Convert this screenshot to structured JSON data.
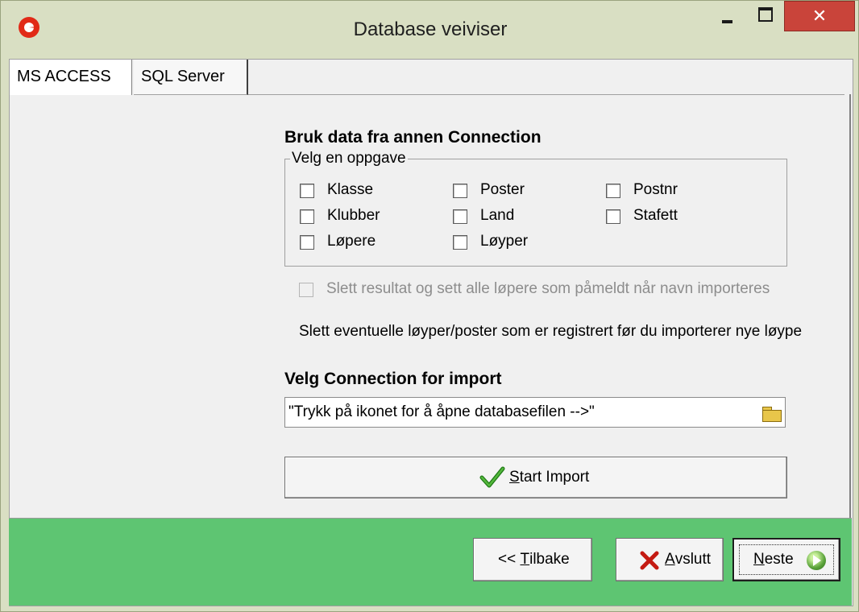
{
  "window": {
    "title": "Database veiviser",
    "app_icon": "app-logo-icon",
    "close_glyph": "✕"
  },
  "tabs": [
    {
      "label": "MS ACCESS",
      "active": true
    },
    {
      "label": "SQL Server",
      "active": false
    }
  ],
  "import_section": {
    "heading": "Bruk data fra annen Connection",
    "group_label": "Velg en oppgave",
    "options": [
      {
        "label": "Klasse",
        "checked": false
      },
      {
        "label": "Klubber",
        "checked": false
      },
      {
        "label": "Løpere",
        "checked": false
      },
      {
        "label": "Poster",
        "checked": false
      },
      {
        "label": "Land",
        "checked": false
      },
      {
        "label": "Løyper",
        "checked": false
      },
      {
        "label": "Postnr",
        "checked": false
      },
      {
        "label": "Stafett",
        "checked": false
      }
    ],
    "reset_option": {
      "label": "Slett resultat og sett alle løpere som påmeldt når navn importeres",
      "checked": false,
      "enabled": false
    },
    "note": "Slett eventuelle løyper/poster som er registrert før du importerer nye løype"
  },
  "connection_section": {
    "heading": "Velg Connection for import",
    "file_value": "\"Trykk på ikonet for å åpne databasefilen -->\"",
    "browse_icon": "open-folder-icon"
  },
  "start_button": {
    "mnemonic": "S",
    "label_rest": "tart Import",
    "icon": "green-check-icon"
  },
  "footer": {
    "colors": {
      "background": "#5ec572"
    },
    "back": {
      "prefix": "<< ",
      "mnemonic": "T",
      "rest": "ilbake"
    },
    "cancel": {
      "mnemonic": "A",
      "rest": "vslutt",
      "icon": "red-x-icon"
    },
    "next": {
      "mnemonic": "N",
      "rest": "este",
      "icon": "next-arrow-icon"
    }
  }
}
